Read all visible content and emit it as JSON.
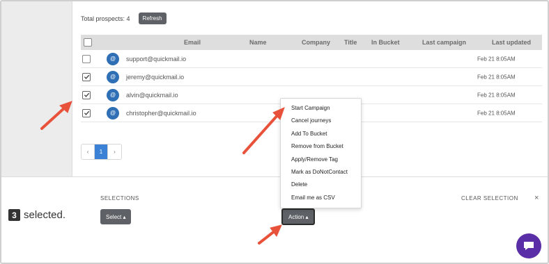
{
  "prospects": {
    "total_label": "Total prospects: 4",
    "refresh_label": "Refresh"
  },
  "table": {
    "columns": [
      "Email",
      "Name",
      "Company",
      "Title",
      "In Bucket",
      "Last campaign",
      "Last updated"
    ],
    "avatar_glyph": "@",
    "rows": [
      {
        "email": "support@quickmail.io",
        "checked": false,
        "last_updated": "Feb 21 8:05AM"
      },
      {
        "email": "jeremy@quickmail.io",
        "checked": true,
        "last_updated": "Feb 21 8:05AM"
      },
      {
        "email": "alvin@quickmail.io",
        "checked": true,
        "last_updated": "Feb 21 8:05AM"
      },
      {
        "email": "christopher@quickmail.io",
        "checked": true,
        "last_updated": "Feb 21 8:05AM"
      }
    ]
  },
  "pagination": {
    "prev": "‹",
    "page": "1",
    "next": "›"
  },
  "selection": {
    "count": "3",
    "selected_text": "selected.",
    "selections_label": "SELECTIONS",
    "clear_label": "CLEAR SELECTION",
    "close_glyph": "×",
    "select_label": "Select ▴",
    "action_label": "Action ▴"
  },
  "action_menu": {
    "items": [
      "Start Campaign",
      "Cancel journeys",
      "Add To Bucket",
      "Remove from Bucket",
      "Apply/Remove Tag",
      "Mark as DoNotContact",
      "Delete",
      "Email me as CSV"
    ]
  },
  "colors": {
    "accent": "#3b82d6",
    "arrow": "#e8523a",
    "chat": "#5a2ea6"
  }
}
